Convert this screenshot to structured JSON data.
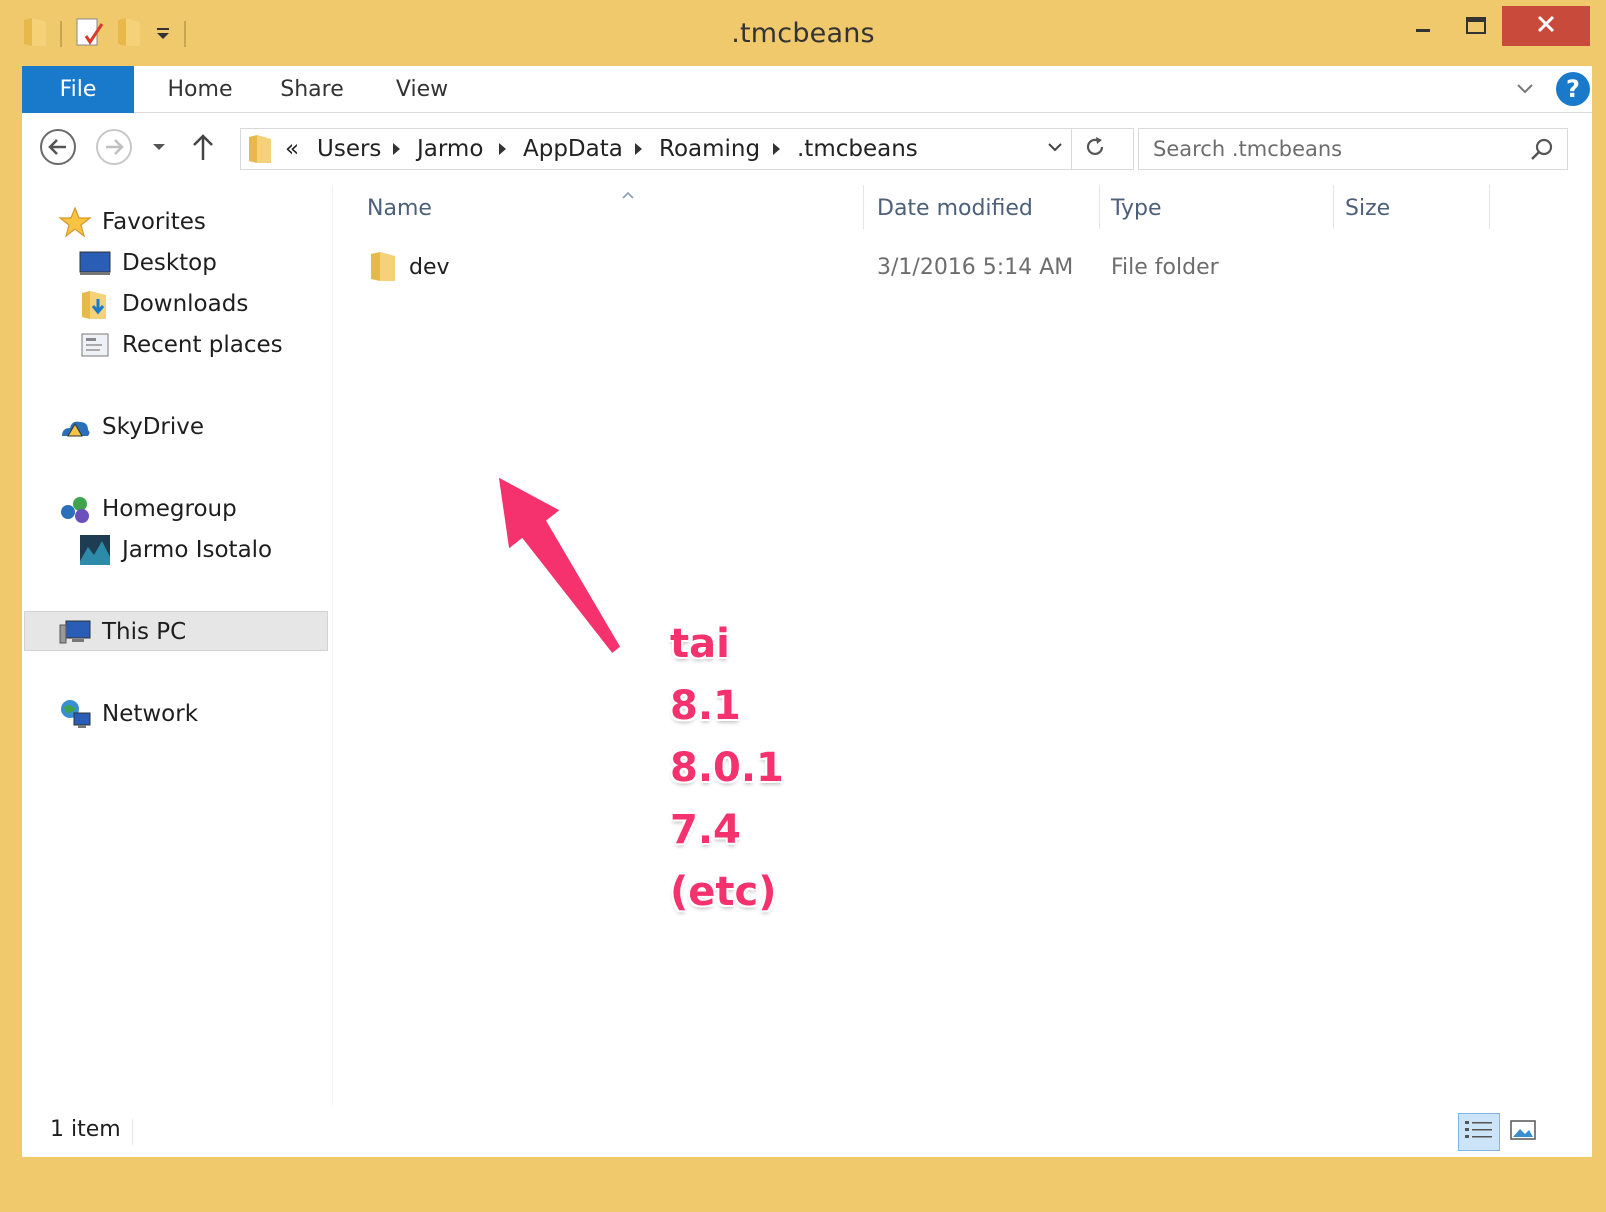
{
  "window": {
    "title": ".tmcbeans"
  },
  "ribbon": {
    "tabs": [
      "File",
      "Home",
      "Share",
      "View"
    ],
    "help_label": "?"
  },
  "address_bar": {
    "overflow": "«",
    "crumbs": [
      "Users",
      "Jarmo",
      "AppData",
      "Roaming",
      ".tmcbeans"
    ]
  },
  "search": {
    "placeholder": "Search .tmcbeans"
  },
  "sidebar": {
    "favorites": {
      "label": "Favorites",
      "items": [
        "Desktop",
        "Downloads",
        "Recent places"
      ]
    },
    "skydrive": "SkyDrive",
    "homegroup": {
      "label": "Homegroup",
      "items": [
        "Jarmo Isotalo"
      ]
    },
    "this_pc": "This PC",
    "network": "Network"
  },
  "file_list": {
    "columns": [
      "Name",
      "Date modified",
      "Type",
      "Size"
    ],
    "rows": [
      {
        "name": "dev",
        "date_modified": "3/1/2016 5:14 AM",
        "type": "File folder",
        "size": ""
      }
    ]
  },
  "annotation": {
    "lines": [
      "tai",
      "8.1",
      "8.0.1",
      "7.4",
      "(etc)"
    ],
    "color": "#f5326d"
  },
  "status_bar": {
    "item_count": "1 item"
  },
  "colors": {
    "frame": "#f0c96c",
    "file_tab": "#1979ca",
    "close_button": "#c74a3a",
    "selected_view": "#cce4f7"
  }
}
